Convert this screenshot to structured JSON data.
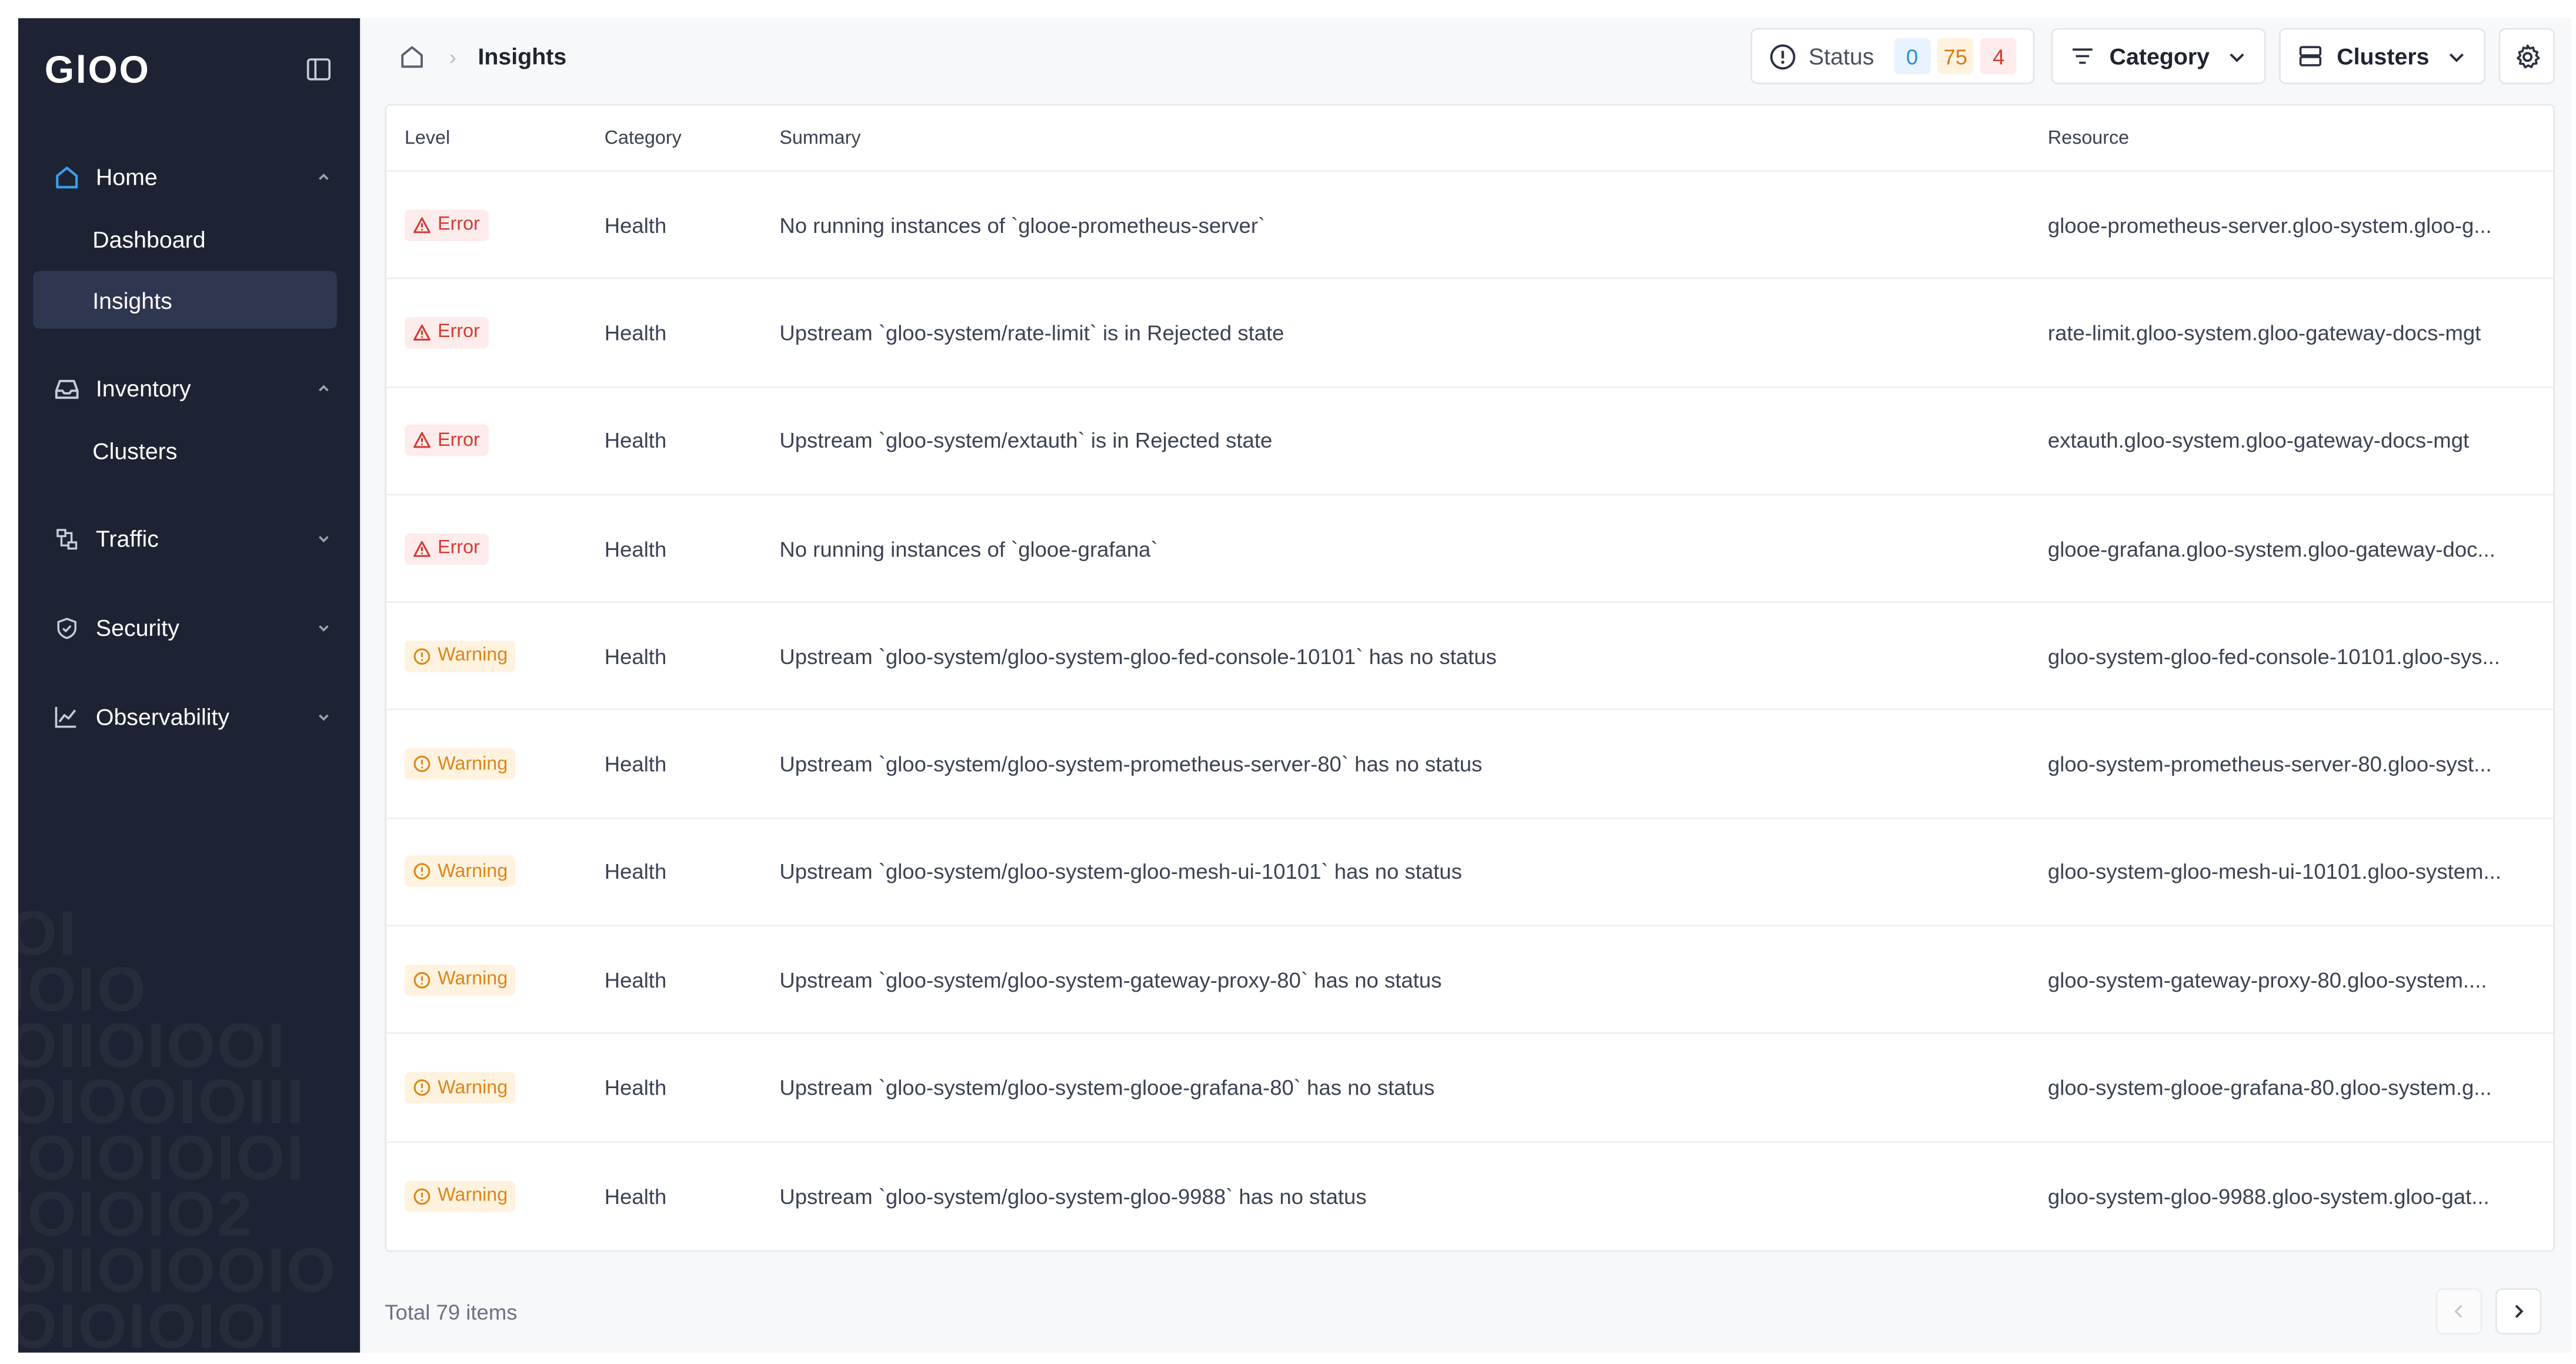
{
  "brand": {
    "logo_text": "GlOO"
  },
  "sidebar": {
    "groups": [
      {
        "label": "Home",
        "icon": "home-icon",
        "expanded": true,
        "items": [
          {
            "label": "Dashboard",
            "active": false
          },
          {
            "label": "Insights",
            "active": true
          }
        ]
      },
      {
        "label": "Inventory",
        "icon": "inbox-icon",
        "expanded": true,
        "items": [
          {
            "label": "Clusters",
            "active": false
          }
        ]
      },
      {
        "label": "Traffic",
        "icon": "traffic-icon",
        "expanded": false,
        "items": []
      },
      {
        "label": "Security",
        "icon": "shield-icon",
        "expanded": false,
        "items": []
      },
      {
        "label": "Observability",
        "icon": "line-chart-icon",
        "expanded": false,
        "items": []
      }
    ]
  },
  "breadcrumb": {
    "current": "Insights"
  },
  "toolbar": {
    "status_label": "Status",
    "status_counts": [
      "0",
      "75",
      "4"
    ],
    "category_label": "Category",
    "clusters_label": "Clusters"
  },
  "table": {
    "columns": {
      "level": "Level",
      "category": "Category",
      "summary": "Summary",
      "resource": "Resource"
    },
    "rows": [
      {
        "level": "Error",
        "category": "Health",
        "summary": "No running instances of `glooe-prometheus-server`",
        "resource": "glooe-prometheus-server.gloo-system.gloo-g..."
      },
      {
        "level": "Error",
        "category": "Health",
        "summary": "Upstream `gloo-system/rate-limit` is in Rejected state",
        "resource": "rate-limit.gloo-system.gloo-gateway-docs-mgt"
      },
      {
        "level": "Error",
        "category": "Health",
        "summary": "Upstream `gloo-system/extauth` is in Rejected state",
        "resource": "extauth.gloo-system.gloo-gateway-docs-mgt"
      },
      {
        "level": "Error",
        "category": "Health",
        "summary": "No running instances of `glooe-grafana`",
        "resource": "glooe-grafana.gloo-system.gloo-gateway-doc..."
      },
      {
        "level": "Warning",
        "category": "Health",
        "summary": "Upstream `gloo-system/gloo-system-gloo-fed-console-10101` has no status",
        "resource": "gloo-system-gloo-fed-console-10101.gloo-sys..."
      },
      {
        "level": "Warning",
        "category": "Health",
        "summary": "Upstream `gloo-system/gloo-system-prometheus-server-80` has no status",
        "resource": "gloo-system-prometheus-server-80.gloo-syst..."
      },
      {
        "level": "Warning",
        "category": "Health",
        "summary": "Upstream `gloo-system/gloo-system-gloo-mesh-ui-10101` has no status",
        "resource": "gloo-system-gloo-mesh-ui-10101.gloo-system..."
      },
      {
        "level": "Warning",
        "category": "Health",
        "summary": "Upstream `gloo-system/gloo-system-gateway-proxy-80` has no status",
        "resource": "gloo-system-gateway-proxy-80.gloo-system...."
      },
      {
        "level": "Warning",
        "category": "Health",
        "summary": "Upstream `gloo-system/gloo-system-glooe-grafana-80` has no status",
        "resource": "gloo-system-glooe-grafana-80.gloo-system.g..."
      },
      {
        "level": "Warning",
        "category": "Health",
        "summary": "Upstream `gloo-system/gloo-system-gloo-9988` has no status",
        "resource": "gloo-system-gloo-9988.gloo-system.gloo-gat..."
      }
    ]
  },
  "footer": {
    "total_text": "Total 79 items"
  },
  "colors": {
    "sidebar_bg": "#1e2333",
    "active_item_bg": "#2f3650",
    "accent": "#3aa0e8",
    "error": "#d23b34",
    "warning": "#e08417"
  }
}
